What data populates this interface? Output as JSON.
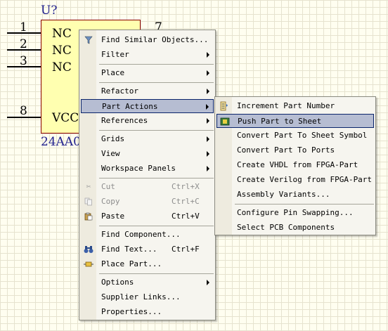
{
  "schematic": {
    "designator": "U?",
    "comment": "24AA0",
    "pins": [
      {
        "number": "1",
        "name": "NC"
      },
      {
        "number": "2",
        "name": "NC"
      },
      {
        "number": "3",
        "name": "NC"
      },
      {
        "number": "8",
        "name": "VCC"
      }
    ],
    "right_pin_number": "7"
  },
  "context_menu": {
    "items": [
      {
        "label": "Find Similar Objects...",
        "shortcut": "",
        "icon": "funnel-icon",
        "submenu": false,
        "disabled": false
      },
      {
        "label": "Filter",
        "submenu": true
      },
      {
        "label": "Place",
        "submenu": true
      },
      {
        "label": "Refactor",
        "submenu": true
      },
      {
        "label": "Part Actions",
        "submenu": true,
        "highlighted": true
      },
      {
        "label": "References",
        "submenu": true
      },
      {
        "label": "Grids",
        "submenu": true
      },
      {
        "label": "View",
        "submenu": true
      },
      {
        "label": "Workspace Panels",
        "submenu": true
      },
      {
        "label": "Cut",
        "shortcut": "Ctrl+X",
        "icon": "scissors-icon",
        "disabled": true
      },
      {
        "label": "Copy",
        "shortcut": "Ctrl+C",
        "icon": "copy-icon",
        "disabled": true
      },
      {
        "label": "Paste",
        "shortcut": "Ctrl+V",
        "icon": "paste-icon",
        "disabled": false
      },
      {
        "label": "Find Component...",
        "shortcut": ""
      },
      {
        "label": "Find Text...",
        "shortcut": "Ctrl+F",
        "icon": "binoculars-icon"
      },
      {
        "label": "Place Part...",
        "shortcut": "",
        "icon": "place-part-icon"
      },
      {
        "label": "Options",
        "submenu": true
      },
      {
        "label": "Supplier Links...",
        "submenu": false
      },
      {
        "label": "Properties...",
        "submenu": false
      }
    ]
  },
  "part_actions_submenu": {
    "items": [
      {
        "label": "Increment Part Number",
        "icon": "increment-icon"
      },
      {
        "label": "Push Part to Sheet",
        "icon": "push-part-icon",
        "highlighted": true
      },
      {
        "label": "Convert Part To Sheet Symbol"
      },
      {
        "label": "Convert Part To Ports"
      },
      {
        "label": "Create VHDL from FPGA-Part"
      },
      {
        "label": "Create Verilog from FPGA-Part"
      },
      {
        "label": "Assembly Variants..."
      },
      {
        "label": "Configure Pin Swapping..."
      },
      {
        "label": "Select PCB Components"
      }
    ]
  },
  "colors": {
    "highlight_bg": "#b6bdd2",
    "highlight_border": "#0a246a",
    "part_fill": "#ffffb0",
    "designator_text": "#1e1e8c"
  }
}
